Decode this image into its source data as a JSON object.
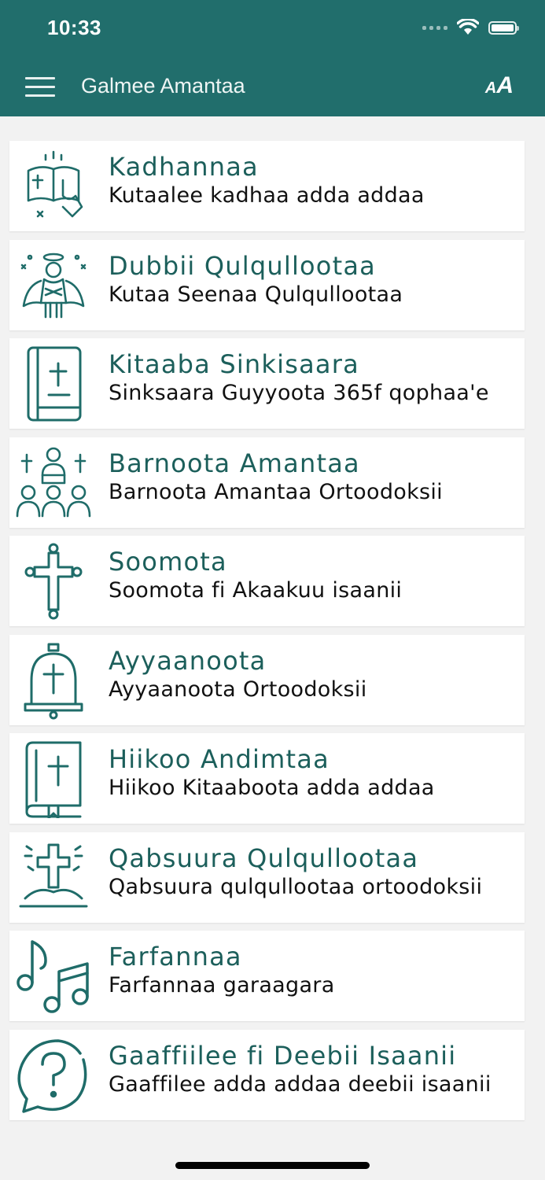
{
  "status_bar": {
    "time": "10:33"
  },
  "header": {
    "title": "Galmee Amantaa",
    "font_button": "AA"
  },
  "colors": {
    "primary": "#216e6c",
    "title_text": "#1c5f5b"
  },
  "items": [
    {
      "title": "Kadhannaa",
      "subtitle": "Kutaalee kadhaa adda addaa",
      "icon": "prayer-book-icon"
    },
    {
      "title": "Dubbii Qulqullootaa",
      "subtitle": "Kutaa Seenaa Qulqullootaa",
      "icon": "angel-icon"
    },
    {
      "title": "Kitaaba Sinkisaara",
      "subtitle": "Sinksaara Guyyoota 365f qophaa'e",
      "icon": "bible-book-icon"
    },
    {
      "title": "Barnoota Amantaa",
      "subtitle": "Barnoota Amantaa Ortoodoksii",
      "icon": "preacher-icon"
    },
    {
      "title": "Soomota",
      "subtitle": "Soomota fi Akaakuu isaanii",
      "icon": "cross-icon"
    },
    {
      "title": "Ayyaanoota",
      "subtitle": "Ayyaanoota Ortoodoksii",
      "icon": "church-bell-icon"
    },
    {
      "title": "Hiikoo Andimtaa",
      "subtitle": "Hiikoo Kitaaboota adda addaa",
      "icon": "holy-book-icon"
    },
    {
      "title": "Qabsuura Qulqullootaa",
      "subtitle": "Qabsuura qulqullootaa ortoodoksii",
      "icon": "grave-cross-icon"
    },
    {
      "title": "Farfannaa",
      "subtitle": "Farfannaa garaagara",
      "icon": "music-notes-icon"
    },
    {
      "title": "Gaaffiilee fi Deebii Isaanii",
      "subtitle": "Gaaffilee adda addaa deebii isaanii",
      "icon": "question-bubble-icon"
    }
  ]
}
